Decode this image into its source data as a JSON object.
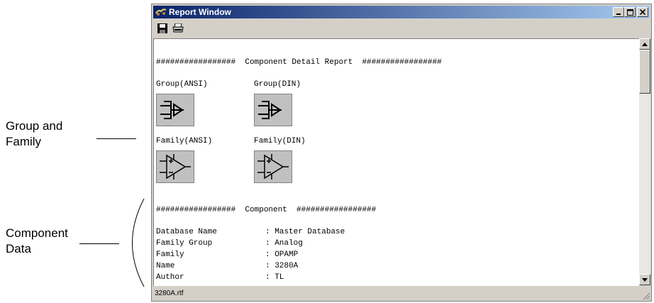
{
  "callouts": {
    "group_family": [
      "Group and",
      "Family"
    ],
    "component_data": [
      "Component",
      "Data"
    ]
  },
  "window": {
    "title": "Report Window",
    "title_icon": "report-window-icon",
    "controls": {
      "minimize": "minimize-icon",
      "maximize": "maximize-icon",
      "close": "close-icon"
    }
  },
  "toolbar": {
    "save_icon": "save-icon",
    "print_icon": "print-icon"
  },
  "report": {
    "header1": "#################  Component Detail Report  #################",
    "symbols": [
      {
        "label": "Group(ANSI)",
        "icon": "group-ansi-symbol-icon"
      },
      {
        "label": "Group(DIN)",
        "icon": "group-din-symbol-icon"
      },
      {
        "label": "Family(ANSI)",
        "icon": "family-ansi-symbol-icon"
      },
      {
        "label": "Family(DIN)",
        "icon": "family-din-symbol-icon"
      }
    ],
    "header2": "#################  Component  #################",
    "fields": [
      {
        "key": "Database Name",
        "value": ": Master Database"
      },
      {
        "key": "Family Group",
        "value": ": Analog"
      },
      {
        "key": "Family",
        "value": ": OPAMP"
      },
      {
        "key": "Name",
        "value": ": 3280A"
      },
      {
        "key": "Author",
        "value": ": TL"
      }
    ]
  },
  "status": {
    "file": "3280A.rtf"
  }
}
